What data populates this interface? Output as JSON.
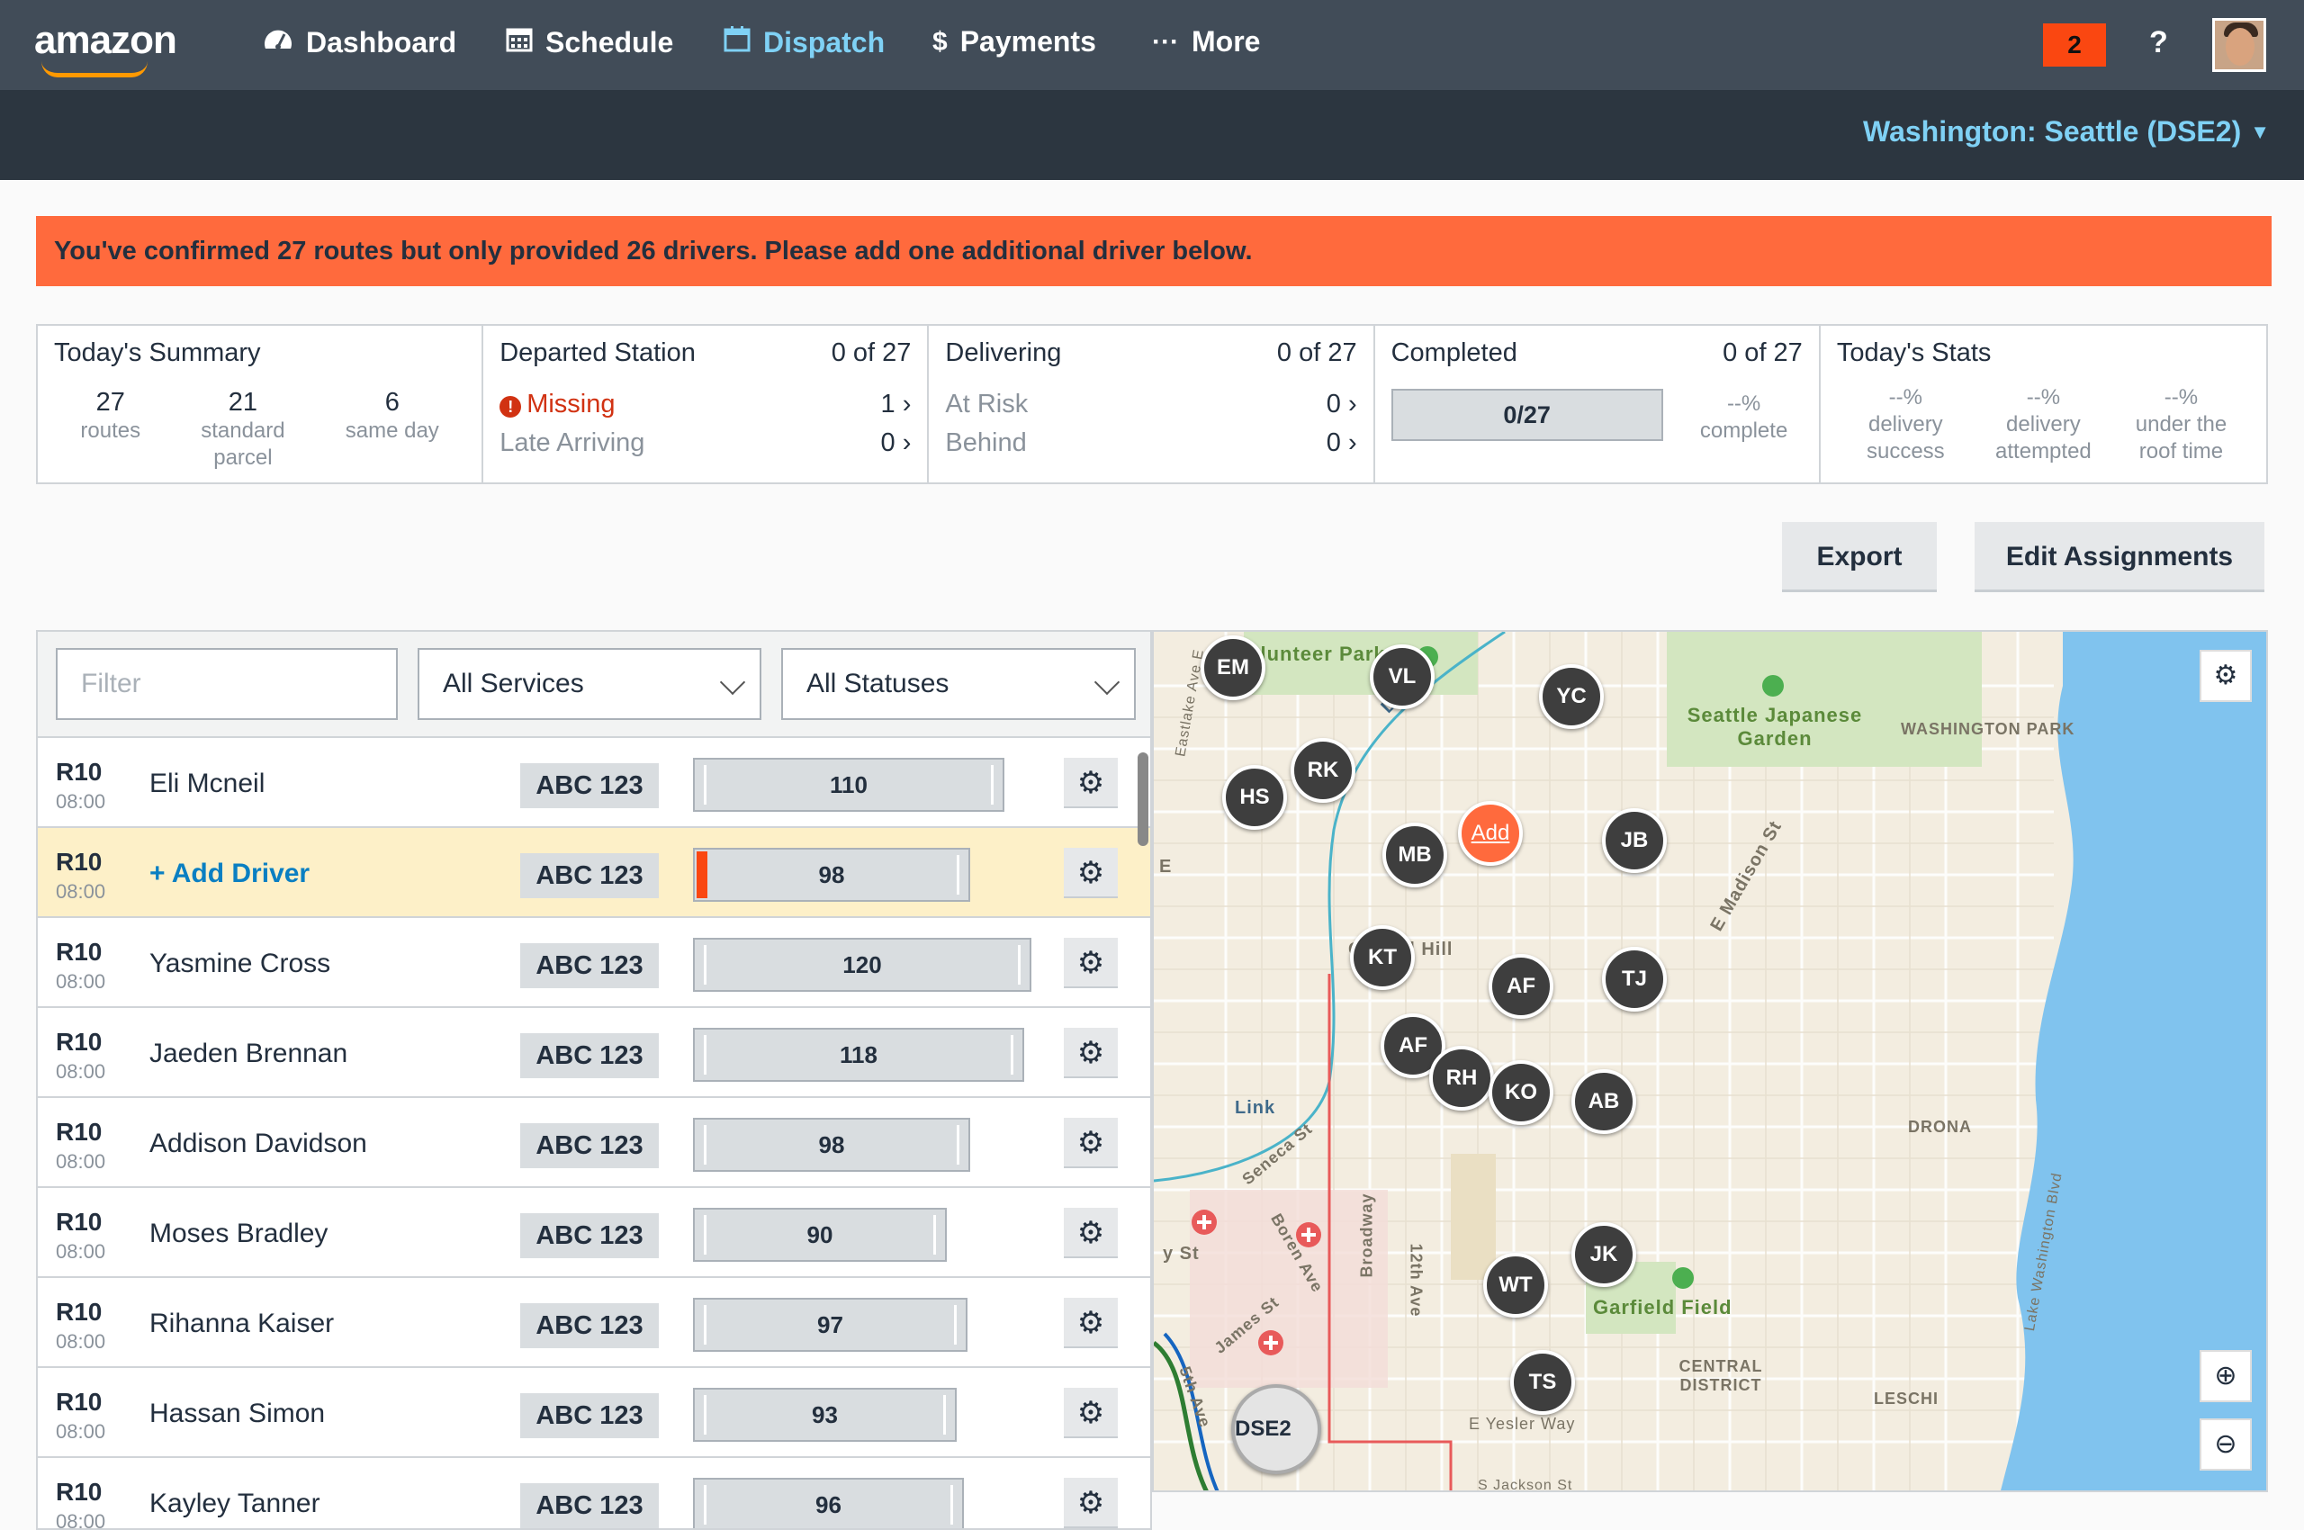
{
  "brand": "amazon",
  "nav": {
    "items": [
      {
        "label": "Dashboard",
        "icon": "dashboard-icon"
      },
      {
        "label": "Schedule",
        "icon": "calendar-icon"
      },
      {
        "label": "Dispatch",
        "icon": "dispatch-calendar-icon",
        "active": true
      },
      {
        "label": "Payments",
        "icon": "dollar-icon"
      },
      {
        "label": "More",
        "icon": "ellipsis-icon"
      }
    ],
    "notification_count": "2",
    "help_label": "?"
  },
  "station_selector": "Washington: Seattle (DSE2)",
  "alert": "You've confirmed 27 routes but only provided 26 drivers. Please add one additional driver below.",
  "summary": {
    "today": {
      "title": "Today's Summary",
      "stats": [
        {
          "value": "27",
          "label": "routes"
        },
        {
          "value": "21",
          "label": "standard parcel"
        },
        {
          "value": "6",
          "label": "same day"
        }
      ]
    },
    "departed": {
      "title": "Departed Station",
      "count": "0 of 27",
      "rows": [
        {
          "label": "Missing",
          "value": "1"
        },
        {
          "label": "Late Arriving",
          "value": "0"
        }
      ]
    },
    "delivering": {
      "title": "Delivering",
      "count": "0 of 27",
      "rows": [
        {
          "label": "At Risk",
          "value": "0"
        },
        {
          "label": "Behind",
          "value": "0"
        }
      ]
    },
    "completed": {
      "title": "Completed",
      "count": "0 of 27",
      "progress_label": "0/27",
      "progress": 0,
      "pct": "--%",
      "pct_label": "complete"
    },
    "stats": {
      "title": "Today's Stats",
      "items": [
        {
          "value": "--%",
          "label": "delivery success"
        },
        {
          "value": "--%",
          "label": "delivery attempted"
        },
        {
          "value": "--%",
          "label": "under the roof time"
        }
      ]
    }
  },
  "actions": {
    "export": "Export",
    "edit": "Edit Assignments"
  },
  "filters": {
    "filter_placeholder": "Filter",
    "services": "All Services",
    "statuses": "All Statuses"
  },
  "routes": [
    {
      "id": "R10",
      "time": "08:00",
      "driver": "Eli Mcneil",
      "vehicle": "ABC 123",
      "packages": "110",
      "fill": 0.92
    },
    {
      "id": "R10",
      "time": "08:00",
      "driver": "+ Add Driver",
      "vehicle": "ABC 123",
      "packages": "98",
      "fill": 0.82,
      "missing": true
    },
    {
      "id": "R10",
      "time": "08:00",
      "driver": "Yasmine Cross",
      "vehicle": "ABC 123",
      "packages": "120",
      "fill": 1.0
    },
    {
      "id": "R10",
      "time": "08:00",
      "driver": "Jaeden Brennan",
      "vehicle": "ABC 123",
      "packages": "118",
      "fill": 0.98
    },
    {
      "id": "R10",
      "time": "08:00",
      "driver": "Addison Davidson",
      "vehicle": "ABC 123",
      "packages": "98",
      "fill": 0.82
    },
    {
      "id": "R10",
      "time": "08:00",
      "driver": "Moses Bradley",
      "vehicle": "ABC 123",
      "packages": "90",
      "fill": 0.75
    },
    {
      "id": "R10",
      "time": "08:00",
      "driver": "Rihanna Kaiser",
      "vehicle": "ABC 123",
      "packages": "97",
      "fill": 0.81
    },
    {
      "id": "R10",
      "time": "08:00",
      "driver": "Hassan Simon",
      "vehicle": "ABC 123",
      "packages": "93",
      "fill": 0.78
    },
    {
      "id": "R10",
      "time": "08:00",
      "driver": "Kayley Tanner",
      "vehicle": "ABC 123",
      "packages": "96",
      "fill": 0.8
    }
  ],
  "map": {
    "pins": [
      "EM",
      "VL",
      "YC",
      "RK",
      "HS",
      "MB",
      "Add",
      "JB",
      "KT",
      "AF",
      "TJ",
      "AF",
      "RH",
      "KO",
      "AB",
      "JK",
      "WT",
      "TS"
    ],
    "station": "DSE2",
    "labels": [
      "Volunteer Park",
      "Seattle Japanese Garden",
      "WASHINGTON PARK",
      "Capitol Hill",
      "E Madison St",
      "Link",
      "Link",
      "Seneca St",
      "Boren Ave",
      "Broadway",
      "12th Ave",
      "James St",
      "5th Ave",
      "Garfield Field",
      "CENTRAL DISTRICT",
      "E Yesler Way",
      "LESCHI",
      "DRONA",
      "Eastlake Ave E",
      "S Jackson St",
      "y St",
      "E",
      "Lake Washington Blvd"
    ]
  }
}
